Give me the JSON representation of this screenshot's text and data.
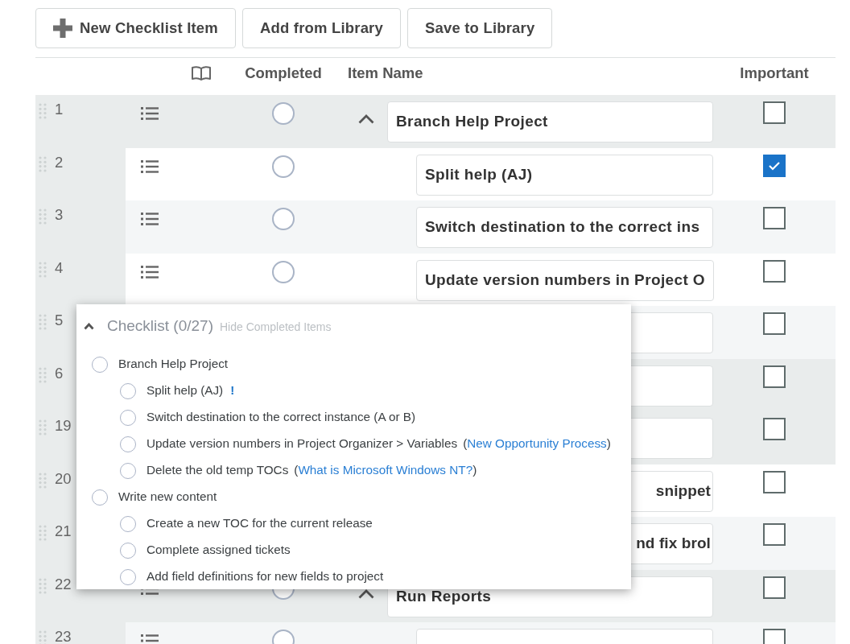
{
  "toolbar": {
    "buttons": [
      {
        "label": "New Checklist Item",
        "kind": "add"
      },
      {
        "label": "Add from Library",
        "kind": "plain"
      },
      {
        "label": "Save to Library",
        "kind": "plain"
      }
    ]
  },
  "table": {
    "columns": [
      "Completed",
      "Item Name",
      "Important"
    ],
    "rows": [
      {
        "number": "1",
        "kind": "parent",
        "expanded": true,
        "completed": false,
        "name": "Branch Help Project",
        "important": false
      },
      {
        "number": "2",
        "kind": "child",
        "completed": false,
        "name": "Split help (AJ)",
        "important": true
      },
      {
        "number": "3",
        "kind": "child",
        "completed": false,
        "name": "Switch destination to the correct ins",
        "important": false
      },
      {
        "number": "4",
        "kind": "child",
        "completed": false,
        "name": "Update version numbers in Project O",
        "important": false
      },
      {
        "number": "5",
        "kind": "child",
        "important": false
      },
      {
        "number": "6",
        "kind": "parent",
        "important": false
      },
      {
        "number": "19",
        "kind": "parent",
        "important": false
      },
      {
        "number": "20",
        "kind": "child",
        "name": "snippet",
        "clipped": true,
        "important": false
      },
      {
        "number": "21",
        "kind": "child",
        "name": "nd fix brol",
        "clipped": true,
        "important": false
      },
      {
        "number": "22",
        "kind": "parent",
        "expanded": true,
        "completed": false,
        "name": "Run Reports",
        "important": false
      },
      {
        "number": "23",
        "kind": "child",
        "completed": false,
        "important": false
      }
    ]
  },
  "checklist_popup": {
    "expanded": true,
    "title": "Checklist (0/27)",
    "action": "Hide Completed Items",
    "items": [
      {
        "label": "Branch Help Project",
        "completed": false,
        "children": [
          {
            "label": "Split help (AJ)",
            "completed": false,
            "flag": "!"
          },
          {
            "label": "Switch destination to the correct instance (A or B)",
            "completed": false
          },
          {
            "label": "Update version numbers in Project Organizer > Variables",
            "completed": false,
            "link": {
              "open": "(",
              "text": "New Opportunity Process",
              "close": ")"
            }
          },
          {
            "label": "Delete the old temp TOCs",
            "completed": false,
            "link": {
              "open": "(",
              "text": "What is Microsoft Windows NT?",
              "close": ")"
            }
          }
        ]
      },
      {
        "label": "Write new content",
        "completed": false,
        "children": [
          {
            "label": "Create a new TOC for the current release",
            "completed": false
          },
          {
            "label": "Complete assigned tickets",
            "completed": false
          },
          {
            "label": "Add field definitions for new fields to project",
            "completed": false
          }
        ]
      }
    ]
  }
}
